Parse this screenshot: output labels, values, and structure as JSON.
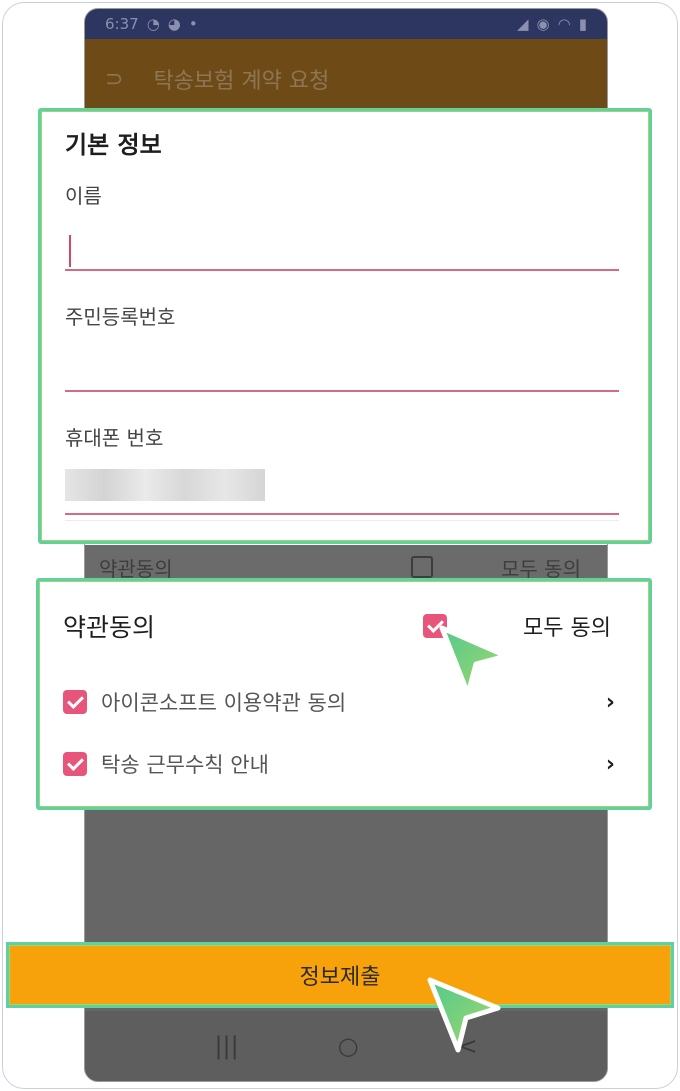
{
  "status": {
    "time": "6:37"
  },
  "appbar": {
    "title": "탁송보험 계약 요청",
    "back_glyph": "⊃"
  },
  "basic": {
    "title": "기본 정보",
    "name_label": "이름",
    "rrn_label": "주민등록번호",
    "phone_label": "휴대폰 번호"
  },
  "terms_dim": {
    "title": "약관동의",
    "all": "모두 동의"
  },
  "terms": {
    "title": "약관동의",
    "all_label": "모두 동의",
    "items": [
      {
        "label": "아이콘소프트 이용약관 동의"
      },
      {
        "label": "탁송 근무수칙 안내"
      }
    ]
  },
  "submit": {
    "label": "정보제출"
  },
  "nav": {
    "recent": "|||",
    "home": "○",
    "back": "<"
  },
  "colors": {
    "accent": "#e8557a",
    "submit": "#f7a20b",
    "highlight": "#5fd0a0"
  }
}
